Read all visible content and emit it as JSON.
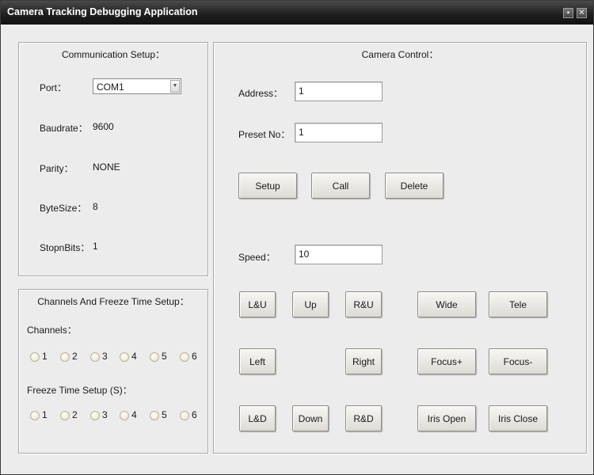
{
  "window": {
    "title": "Camera Tracking Debugging Application"
  },
  "communication": {
    "title": "Communication Setup：",
    "port_label": "Port：",
    "port_value": "COM1",
    "baudrate_label": "Baudrate：",
    "baudrate_value": "9600",
    "parity_label": "Parity：",
    "parity_value": "NONE",
    "bytesize_label": "ByteSize：",
    "bytesize_value": "8",
    "stopbits_label": "StopnBits：",
    "stopbits_value": "1"
  },
  "channels": {
    "title": "Channels And Freeze Time Setup：",
    "channels_label": "Channels：",
    "channel_options": [
      "1",
      "2",
      "3",
      "4",
      "5",
      "6"
    ],
    "freeze_label": "Freeze Time Setup (S)：",
    "freeze_options": [
      "1",
      "2",
      "3",
      "4",
      "5",
      "6"
    ]
  },
  "camera": {
    "title": "Camera Control：",
    "address_label": "Address：",
    "address_value": "1",
    "preset_label": "Preset No：",
    "preset_value": "1",
    "setup_label": "Setup",
    "call_label": "Call",
    "delete_label": "Delete",
    "speed_label": "Speed：",
    "speed_value": "10",
    "buttons": {
      "lu": "L&U",
      "up": "Up",
      "ru": "R&U",
      "left": "Left",
      "right": "Right",
      "ld": "L&D",
      "down": "Down",
      "rd": "R&D",
      "wide": "Wide",
      "tele": "Tele",
      "focus_plus": "Focus+",
      "focus_minus": "Focus-",
      "iris_open": "Iris Open",
      "iris_close": "Iris Close"
    }
  }
}
